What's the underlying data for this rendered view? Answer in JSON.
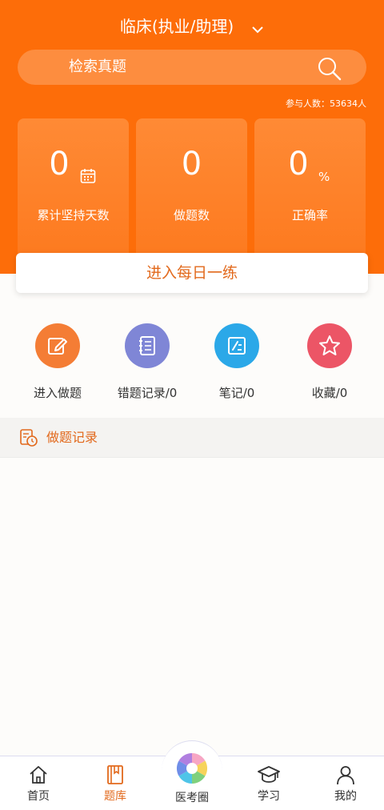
{
  "header": {
    "title": "临床(执业/助理)",
    "search_placeholder": "检索真题",
    "participants": "参与人数：53634人"
  },
  "stats": [
    {
      "value": "0",
      "label": "累计坚持天数",
      "icon": "calendar-icon"
    },
    {
      "value": "0",
      "label": "做题数"
    },
    {
      "value": "0",
      "unit": "%",
      "label": "正确率"
    }
  ],
  "daily_practice_label": "进入每日一练",
  "features": [
    {
      "label": "进入做题",
      "icon": "edit-icon",
      "color": "#f47d35"
    },
    {
      "label": "错题记录/0",
      "icon": "notebook-icon",
      "color": "#7f86d6"
    },
    {
      "label": "笔记/0",
      "icon": "note-icon",
      "color": "#2ba8e8"
    },
    {
      "label": "收藏/0",
      "icon": "star-icon",
      "color": "#ec5566"
    }
  ],
  "record_label": "做题记录",
  "tabs": [
    {
      "label": "首页",
      "icon": "home-icon"
    },
    {
      "label": "题库",
      "icon": "book-icon",
      "active": true
    },
    {
      "label": "医考圈",
      "icon": "aperture-logo-icon"
    },
    {
      "label": "学习",
      "icon": "graduation-cap-icon"
    },
    {
      "label": "我的",
      "icon": "user-icon"
    }
  ],
  "colors": {
    "brand": "#fd6d09",
    "accent_text": "#e2691c"
  }
}
